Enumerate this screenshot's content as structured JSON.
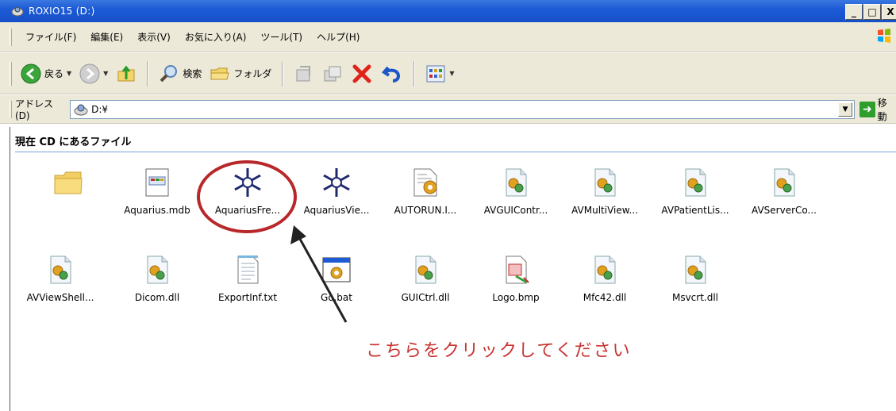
{
  "window": {
    "title": "ROXIO15 (D:)",
    "buttons": {
      "minimize": "_",
      "maximize": "□",
      "close": "X"
    }
  },
  "menu": {
    "items": [
      "ファイル(F)",
      "編集(E)",
      "表示(V)",
      "お気に入り(A)",
      "ツール(T)",
      "ヘルプ(H)"
    ]
  },
  "toolbar": {
    "back_label": "戻る",
    "search_label": "検索",
    "folders_label": "フォルダ"
  },
  "address": {
    "label": "アドレス(D)",
    "value": "D:¥",
    "go_label": "移動"
  },
  "content": {
    "section_header": "現在 CD にあるファイル",
    "files": [
      {
        "name": "",
        "icon": "folder-icon"
      },
      {
        "name": "Aquarius.mdb",
        "icon": "database-file-icon"
      },
      {
        "name": "AquariusFre...",
        "icon": "aquarius-app-icon"
      },
      {
        "name": "AquariusVie...",
        "icon": "aquarius-app-icon"
      },
      {
        "name": "AUTORUN.I...",
        "icon": "config-file-icon"
      },
      {
        "name": "AVGUIContr...",
        "icon": "dll-file-icon"
      },
      {
        "name": "AVMultiView...",
        "icon": "dll-file-icon"
      },
      {
        "name": "AVPatientLis...",
        "icon": "dll-file-icon"
      },
      {
        "name": "AVServerCo...",
        "icon": "dll-file-icon"
      },
      {
        "name": "AVViewShell...",
        "icon": "dll-file-icon"
      },
      {
        "name": "Dicom.dll",
        "icon": "dll-file-icon"
      },
      {
        "name": "ExportInf.txt",
        "icon": "text-file-icon"
      },
      {
        "name": "Go.bat",
        "icon": "batch-file-icon"
      },
      {
        "name": "GUICtrl.dll",
        "icon": "dll-file-icon"
      },
      {
        "name": "Logo.bmp",
        "icon": "bitmap-file-icon"
      },
      {
        "name": "Mfc42.dll",
        "icon": "dll-file-icon"
      },
      {
        "name": "Msvcrt.dll",
        "icon": "dll-file-icon"
      }
    ]
  },
  "annotation": {
    "text": "こちらをクリックしてください",
    "color": "#c8322f"
  }
}
